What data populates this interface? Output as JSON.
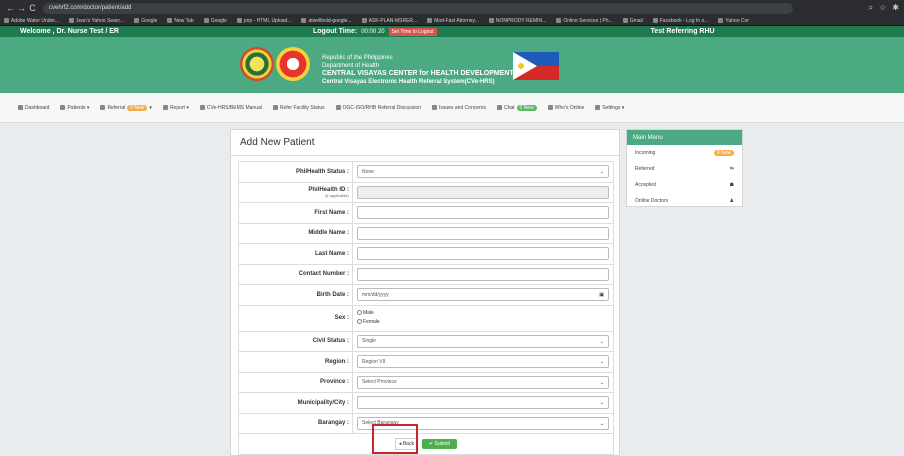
{
  "browser": {
    "url": "cvehrf2.com/doctor/patient/add",
    "nav_back": "←",
    "nav_forward": "→",
    "nav_reload": "C",
    "bookmarks": [
      "Adobe Water Under...",
      "Jean's Yahoo Searc...",
      "Google",
      "New Tab",
      "Google",
      "pnp - HTML Upload...",
      "atwellbold-google...",
      "ASK-PLAN-MSRER...",
      "Mod-Fast Attorney...",
      "NONPRODY REMIN...",
      "Online Services | Ph...",
      "Gmail",
      "Facebook - Log In o...",
      "Yahoo Cor"
    ]
  },
  "infobar": {
    "welcome": "Welcome , Dr. Nurse Test / ER",
    "logout_label": "Logout Time:",
    "logout_time": "00:00 20",
    "set_logout": "Set Time to Logout",
    "facility": "Test Referring RHU"
  },
  "header": {
    "line1": "Republic of the Philippines",
    "line2": "Department of Health",
    "line3": "CENTRAL VISAYAS CENTER for HEALTH DEVELOPMENT",
    "line4": "Central Visayas Electronic Health Referral System(CVe-HRS)"
  },
  "nav": [
    {
      "label": "Dashboard"
    },
    {
      "label": "Patients ▾"
    },
    {
      "label": "Referral",
      "badge": "0 New",
      "suffix": "▾"
    },
    {
      "label": "Report ▾"
    },
    {
      "label": "CVe-HRS/BEMS Manual"
    },
    {
      "label": "Refer Facility Status"
    },
    {
      "label": "OGC-ISO/RHB Referral Discussion"
    },
    {
      "label": "Issues and Concerns"
    },
    {
      "label": "Chat",
      "badge": "0 New",
      "badge_color": "green"
    },
    {
      "label": "Who's Online"
    },
    {
      "label": "Settings ▾"
    }
  ],
  "form": {
    "title": "Add New Patient",
    "philhealth_status": {
      "label": "PhilHealth Status :",
      "value": "None"
    },
    "philhealth_id": {
      "label": "PhilHealth ID :",
      "sub": "(if applicable)",
      "value": ""
    },
    "first_name": {
      "label": "First Name :",
      "value": ""
    },
    "middle_name": {
      "label": "Middle Name :",
      "value": ""
    },
    "last_name": {
      "label": "Last Name :",
      "value": ""
    },
    "contact_number": {
      "label": "Contact Number :",
      "value": ""
    },
    "birth_date": {
      "label": "Birth Date :",
      "placeholder": "mm/dd/yyyy"
    },
    "sex": {
      "label": "Sex :",
      "options": [
        "Male",
        "Female"
      ]
    },
    "civil_status": {
      "label": "Civil Status :",
      "value": "Single"
    },
    "region": {
      "label": "Region :",
      "value": "Region VII"
    },
    "province": {
      "label": "Province :",
      "value": "Select Province"
    },
    "municipality": {
      "label": "Municipality/City :",
      "value": ""
    },
    "barangay": {
      "label": "Barangay :",
      "value": "Select Barangay"
    },
    "back_label": "Back",
    "submit_label": "Submit"
  },
  "side_menu": {
    "title": "Main Menu",
    "items": [
      {
        "label": "Incoming",
        "badge": "0 New"
      },
      {
        "label": "Referred"
      },
      {
        "label": "Accepted"
      },
      {
        "label": "Online Doctors"
      }
    ]
  },
  "colors": {
    "brand_green": "#4caa82",
    "header_bar": "#1f7a4d",
    "badge_orange": "#f0ad4e",
    "submit_green": "#4cae4c",
    "highlight_red": "#c0282a"
  }
}
